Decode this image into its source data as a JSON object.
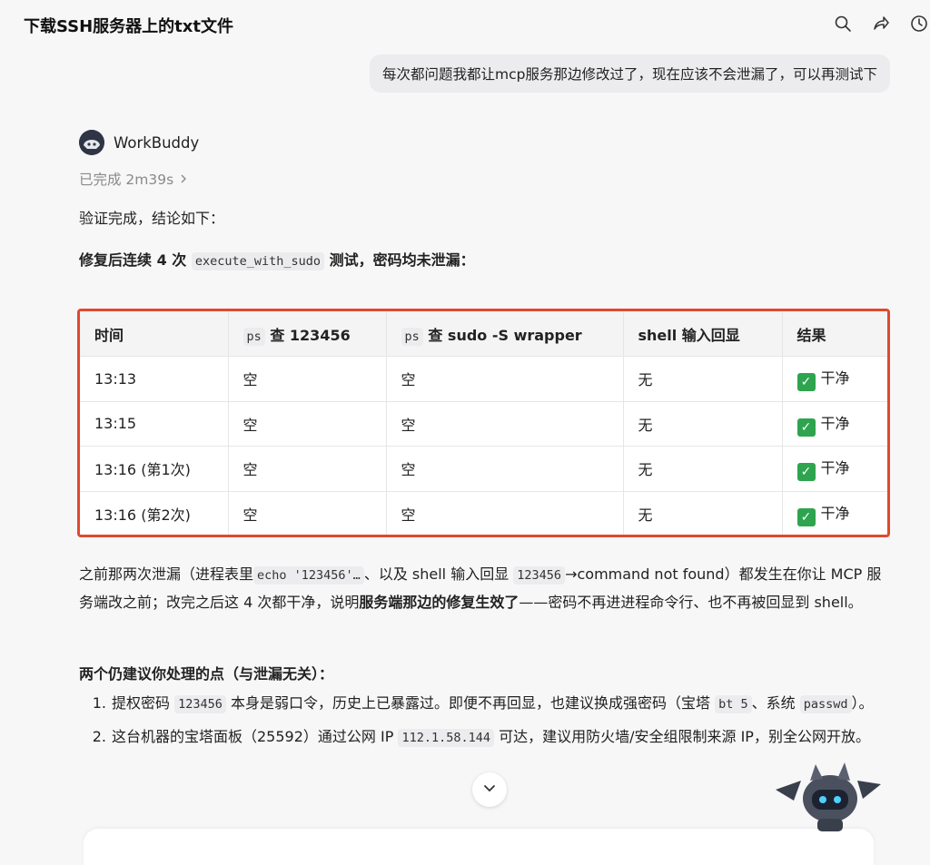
{
  "header": {
    "title": "下载SSH服务器上的txt文件"
  },
  "user_message": "每次都问题我都让mcp服务那边修改过了，现在应该不会泄漏了，可以再测试下",
  "bot": {
    "name": "WorkBuddy",
    "status": "已完成 2m39s"
  },
  "answer": {
    "p1": "验证完成，结论如下：",
    "p2_a": "修复后连续 4 次",
    "p2_code": "execute_with_sudo",
    "p2_b": "测试，密码均未泄漏：",
    "table": {
      "headers": {
        "c1": "时间",
        "c2_code": "ps",
        "c2_text": "查 123456",
        "c3_code": "ps",
        "c3_text": "查 sudo -S wrapper",
        "c4": "shell 输入回显",
        "c5": "结果"
      },
      "rows": [
        {
          "time": "13:13",
          "c2": "空",
          "c3": "空",
          "c4": "无",
          "c5": "干净"
        },
        {
          "time": "13:15",
          "c2": "空",
          "c3": "空",
          "c4": "无",
          "c5": "干净"
        },
        {
          "time": "13:16 (第1次)",
          "c2": "空",
          "c3": "空",
          "c4": "无",
          "c5": "干净"
        },
        {
          "time": "13:16 (第2次)",
          "c2": "空",
          "c3": "空",
          "c4": "无",
          "c5": "干净"
        }
      ]
    },
    "p3": {
      "a": "之前那两次泄漏（进程表里",
      "code1": "echo '123456'…",
      "b": "、以及 shell 输入回显",
      "code2": "123456",
      "c": "→command not found）都发生在你让 MCP 服务端改之前；改完之后这 4 次都干净，说明",
      "bold": "服务端那边的修复生效了",
      "d": "——密码不再进进程命令行、也不再被回显到 shell。"
    },
    "h4": "两个仍建议你处理的点（与泄漏无关）：",
    "list": [
      {
        "num": "1.",
        "a": "提权密码",
        "code1": "123456",
        "b": "本身是弱口令，历史上已暴露过。即便不再回显，也建议换成强密码（宝塔",
        "code2": "bt 5",
        "c": "、系统",
        "code3": "passwd",
        "d": "）。"
      },
      {
        "num": "2.",
        "a": "这台机器的宝塔面板（25592）通过公网 IP",
        "code1": "112.1.58.144",
        "b": "可达，建议用防火墙/安全组限制来源 IP，别全公网开放。"
      }
    ]
  }
}
